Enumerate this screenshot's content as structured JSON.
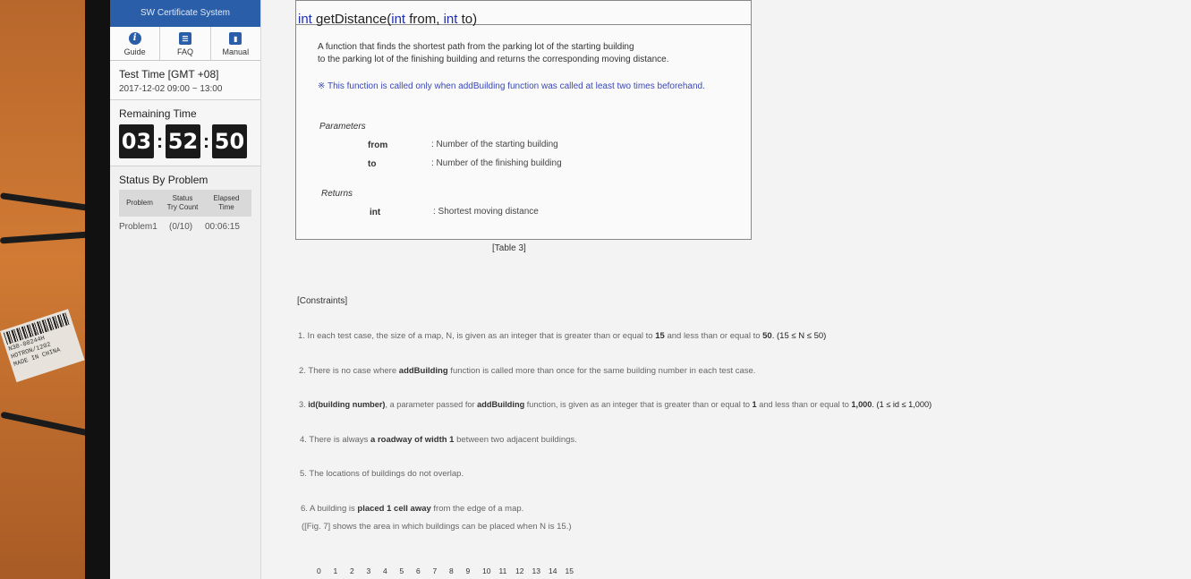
{
  "sidebar": {
    "system_title": "SW Certificate System",
    "tools": [
      {
        "label": "Guide",
        "icon": "info-icon"
      },
      {
        "label": "FAQ",
        "icon": "list-icon"
      },
      {
        "label": "Manual",
        "icon": "book-icon"
      }
    ],
    "test_time_label": "Test Time [GMT +08]",
    "test_time_value": "2017-12-02 09:00 ~ 13:00",
    "remaining_label": "Remaining Time",
    "timer": {
      "h": "03",
      "m": "52",
      "s": "50"
    },
    "status_label": "Status By Problem",
    "status_headers": {
      "problem": "Problem",
      "status": "Status",
      "try_count": "Try Count",
      "elapsed": "Elapsed",
      "time": "Time"
    },
    "status_rows": [
      {
        "problem": "Problem1",
        "count": "(0/10)",
        "elapsed": "00:06:15"
      }
    ]
  },
  "function_box": {
    "ret_type": "int",
    "name": "getDistance(",
    "param1_type": "int",
    "param1_name": " from, ",
    "param2_type": "int",
    "param2_name": " to)",
    "desc_line1": "A function that finds the shortest path from the parking lot of the starting building",
    "desc_line2": "to the parking lot of the finishing building and returns the corresponding moving distance.",
    "note": "※ This function is called only when addBuilding function was called at least two times beforehand.",
    "parameters_label": "Parameters",
    "params": [
      {
        "name": "from",
        "desc": ": Number of the starting building"
      },
      {
        "name": "to",
        "desc": ": Number of the finishing building"
      }
    ],
    "returns_label": "Returns",
    "ret_name": "int",
    "ret_desc": ": Shortest moving distance"
  },
  "caption": "[Table 3]",
  "constraints_header": "[Constraints]",
  "constraints": {
    "c1_a": "1. In each test case, the size of a map, N, is given as an integer that is greater than or equal to ",
    "c1_b": "15",
    "c1_c": " and less than or equal to ",
    "c1_d": "50",
    "c1_e": ". (15 ≤ N ≤ 50)",
    "c2_a": "2. There is no case where ",
    "c2_b": "addBuilding",
    "c2_c": " function is called more than once for the same building number in each test case.",
    "c3_a": "3. ",
    "c3_b": "id(building number)",
    "c3_c": ", a parameter passed for ",
    "c3_d": "addBuilding",
    "c3_e": " function, is given as an integer that is greater than or equal to ",
    "c3_f": "1",
    "c3_g": " and less than or equal to ",
    "c3_h": "1,000",
    "c3_i": ". (1 ≤ id ≤ 1,000)",
    "c4_a": "4. There is always ",
    "c4_b": "a roadway of width 1",
    "c4_c": " between two adjacent buildings.",
    "c5": "5. The locations of buildings do not overlap.",
    "c6_a": "6. A building is ",
    "c6_b": "placed 1 cell away",
    "c6_c": " from the edge of a map.",
    "c6_note": "([Fig. 7] shows the area in which buildings can be placed when N is 15.)"
  },
  "axis_numbers": [
    "0",
    "1",
    "2",
    "3",
    "4",
    "5",
    "6",
    "7",
    "8",
    "9",
    "10",
    "11",
    "12",
    "13",
    "14",
    "15"
  ],
  "sticker": {
    "line1": "HOTRON/1202",
    "line2": "MADE IN CHINA",
    "code": "N38-00244H"
  }
}
